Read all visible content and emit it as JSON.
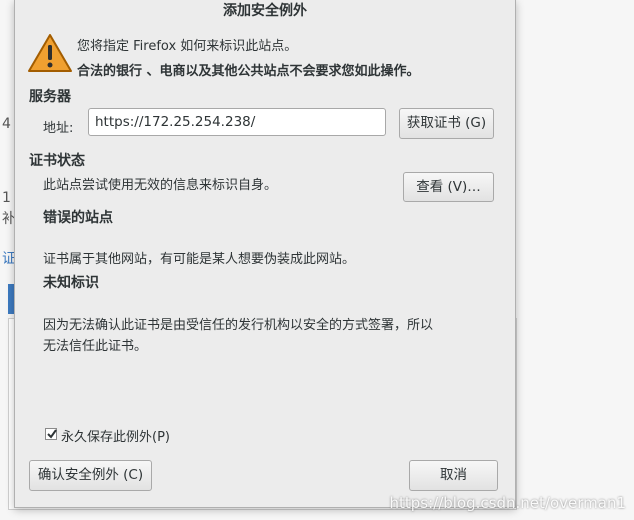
{
  "dialog": {
    "title": "添加安全例外",
    "intro": "您将指定 Firefox 如何来标识此站点。",
    "warning": "合法的银行 、电商以及其他公共站点不会要求您如此操作。",
    "server_heading": "服务器",
    "address_label": "地址:",
    "address_value": "https://172.25.254.238/",
    "get_cert_button": "获取证书 (G)",
    "cert_status_heading": "证书状态",
    "cert_status_text": "此站点尝试使用无效的信息来标识自身。",
    "view_button": "查看 (V)…",
    "wrong_site_heading": "错误的站点",
    "wrong_site_text": "证书属于其他网站，有可能是某人想要伪装成此网站。",
    "unknown_id_heading": "未知标识",
    "unknown_id_text_1": "因为无法确认此证书是由受信任的发行机构以安全的方式签署，所以",
    "unknown_id_text_2": "无法信任此证书。",
    "permanent_checkbox_label": "永久保存此例外(P)",
    "permanent_checked": true,
    "confirm_button": "确认安全例外 (C)",
    "cancel_button": "取消"
  },
  "background": {
    "frag_1": "4",
    "frag_2": "1",
    "frag_3": "补",
    "frag_4": "证"
  },
  "watermark": "https://blog.csdn.net/overman1",
  "colors": {
    "warning_icon": "#f0a030",
    "accent_blue": "#3d7ac0"
  },
  "icons": {
    "warning": "warning-triangle-icon",
    "check": "checkmark-icon"
  }
}
